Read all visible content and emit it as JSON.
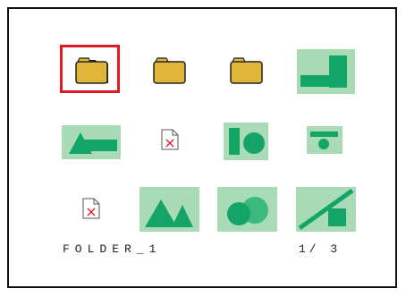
{
  "viewer": {
    "folder_name": "FOLDER_1",
    "page_indicator": "1/ 3",
    "selected_index": 0,
    "items": [
      {
        "kind": "folder",
        "icon": "folder-icon"
      },
      {
        "kind": "folder",
        "icon": "folder-icon"
      },
      {
        "kind": "folder",
        "icon": "folder-icon"
      },
      {
        "kind": "image-thumbnail",
        "icon": "image-thumbnail-icon"
      },
      {
        "kind": "image-thumbnail",
        "icon": "image-thumbnail-icon"
      },
      {
        "kind": "broken-file",
        "icon": "broken-file-icon"
      },
      {
        "kind": "image-thumbnail",
        "icon": "image-thumbnail-icon"
      },
      {
        "kind": "image-thumbnail",
        "icon": "image-thumbnail-icon"
      },
      {
        "kind": "broken-file",
        "icon": "broken-file-icon"
      },
      {
        "kind": "image-thumbnail",
        "icon": "image-thumbnail-icon"
      },
      {
        "kind": "image-thumbnail",
        "icon": "image-thumbnail-icon"
      },
      {
        "kind": "image-thumbnail",
        "icon": "image-thumbnail-icon"
      }
    ],
    "colors": {
      "selection": "#e01a22",
      "folder": "#e0b63a",
      "thumb_bg": "#a9dcb6",
      "thumb_shape": "#14a468"
    }
  }
}
